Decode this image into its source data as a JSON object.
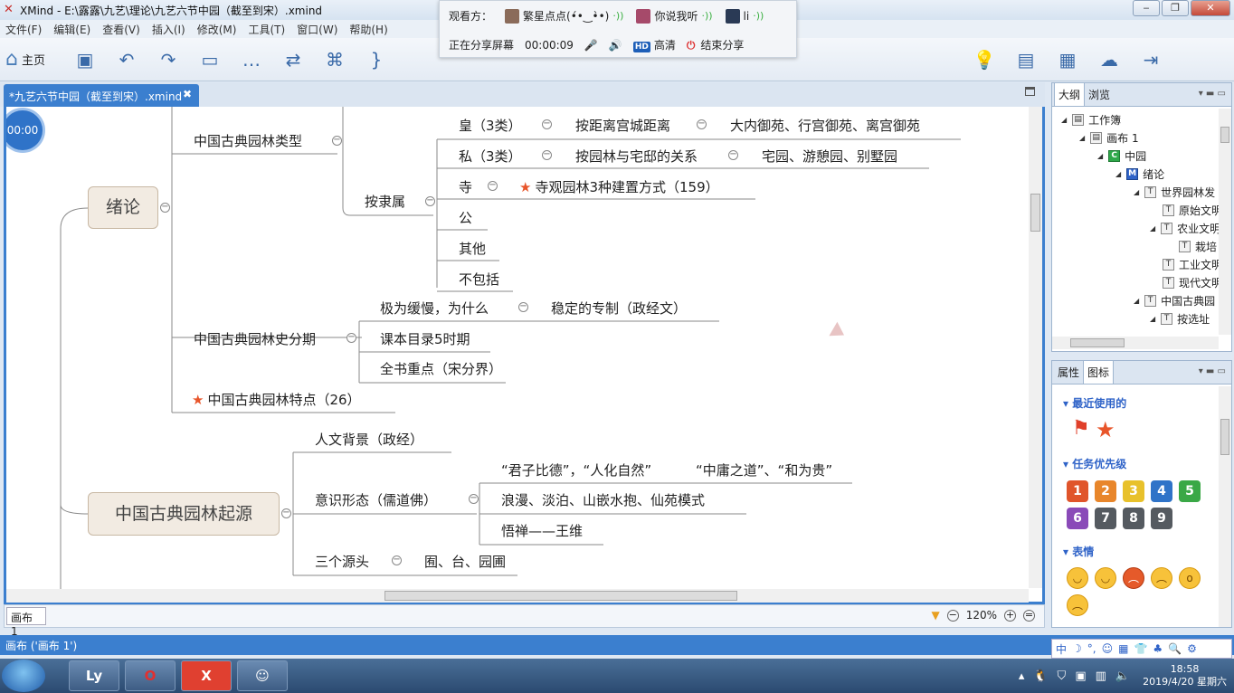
{
  "window": {
    "title": "XMind - E:\\露露\\九艺\\理论\\九艺六节中园（截至到宋）.xmind",
    "controls": [
      "‒",
      "❐",
      "✕"
    ]
  },
  "menu": [
    "文件(F)",
    "编辑(E)",
    "查看(V)",
    "插入(I)",
    "修改(M)",
    "工具(T)",
    "窗口(W)",
    "帮助(H)"
  ],
  "toolbar": {
    "home_label": "主页"
  },
  "share": {
    "viewers_label": "观看方：",
    "viewers": [
      "繁星点点(•́•‿•̀•)",
      "你说我听",
      "li"
    ],
    "sharing_label": "正在分享屏幕",
    "elapsed": "00:00:09",
    "quality": "高清",
    "hd_badge": "HD",
    "stop_label": "结束分享"
  },
  "doc_tab": {
    "label": "*九艺六节中园（截至到宋）.xmind",
    "close": "✖"
  },
  "timer": "00:00",
  "mindmap": {
    "topic1": "绪论",
    "types": "中国古典园林类型",
    "by_owner": "按隶属",
    "imperial": "皇（3类）",
    "imperial_basis": "按距离宫城距离",
    "imperial_examples": "大内御苑、行宫御苑、离宫御苑",
    "private": "私（3类）",
    "private_basis": "按园林与宅邸的关系",
    "private_examples": "宅园、游憩园、别墅园",
    "temple": "寺",
    "temple_note": "寺观园林3种建置方式（159）",
    "public": "公",
    "other": "其他",
    "excluded": "不包括",
    "history": "中国古典园林史分期",
    "slow": "极为缓慢，为什么",
    "slow_reason": "稳定的专制（政经文）",
    "catalog": "课本目录5时期",
    "focus": "全书重点（宋分界）",
    "features": "中国古典园林特点（26）",
    "topic2": "中国古典园林起源",
    "humanities": "人文背景（政经）",
    "ideology": "意识形态（儒道佛）",
    "virtue": "“君子比德”，“人化自然”",
    "mean": "“中庸之道”、“和为贵”",
    "romantic": "浪漫、淡泊、山嵌水抱、仙苑模式",
    "zen": "悟禅——王维",
    "three_sources": "三个源头",
    "sources": "囿、台、园圃"
  },
  "sheet_tab": "画布 1",
  "zoom": "120%",
  "status": "画布 ('画布 1')",
  "outline_panel": {
    "tabs": [
      "大纲",
      "浏览"
    ],
    "items": [
      {
        "label": "工作簿",
        "icon": "workbook-icon"
      },
      {
        "label": "画布 1",
        "icon": "sheet-icon"
      },
      {
        "label": "中园",
        "icon": "central-topic-icon",
        "badge": "C"
      },
      {
        "label": "绪论",
        "icon": "main-topic-icon",
        "badge": "M"
      },
      {
        "label": "世界园林发",
        "icon": "topic-icon",
        "badge": "T"
      },
      {
        "label": "原始文明",
        "icon": "topic-icon",
        "badge": "T"
      },
      {
        "label": "农业文明",
        "icon": "topic-icon",
        "badge": "T"
      },
      {
        "label": "栽培",
        "icon": "topic-icon",
        "badge": "T"
      },
      {
        "label": "工业文明",
        "icon": "topic-icon",
        "badge": "T"
      },
      {
        "label": "现代文明",
        "icon": "topic-icon",
        "badge": "T"
      },
      {
        "label": "中国古典园",
        "icon": "topic-icon",
        "badge": "T"
      },
      {
        "label": "按选址",
        "icon": "topic-icon",
        "badge": "T"
      }
    ]
  },
  "icon_panel": {
    "tabs": [
      "属性",
      "图标"
    ],
    "recent": "最近使用的",
    "priority": "任务优先级",
    "priorities": [
      "1",
      "2",
      "3",
      "4",
      "5",
      "6",
      "7",
      "8",
      "9"
    ],
    "priority_colors": [
      "#e0552b",
      "#e8862b",
      "#e8c12b",
      "#2f73c8",
      "#3aa846",
      "#8a4ab8",
      "#555a60",
      "#555a60",
      "#555a60"
    ],
    "emotion": "表情"
  },
  "ime": [
    "中",
    "☽",
    "°,",
    "☺",
    "▦",
    "👕",
    "♣",
    "🔍",
    "⚙"
  ],
  "taskbar": {
    "apps": [
      "Ly",
      "O",
      "X",
      "☺"
    ]
  },
  "clock": {
    "time": "18:58",
    "date": "2019/4/20 星期六"
  }
}
